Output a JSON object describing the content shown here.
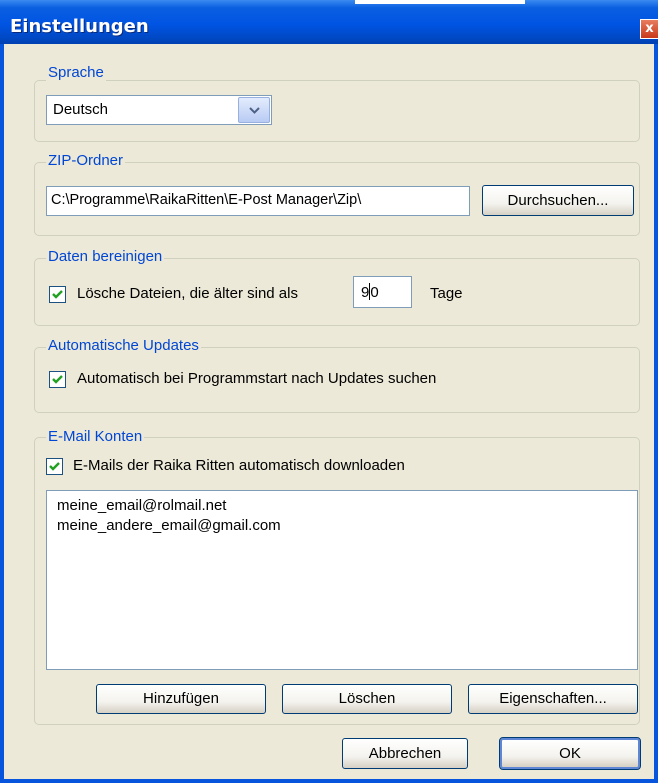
{
  "window": {
    "title": "Einstellungen",
    "close_glyph": "x"
  },
  "language": {
    "legend": "Sprache",
    "selected": "Deutsch"
  },
  "zip": {
    "legend": "ZIP-Ordner",
    "path": "C:\\Programme\\RaikaRitten\\E-Post Manager\\Zip\\",
    "browse_label": "Durchsuchen..."
  },
  "cleanup": {
    "legend": "Daten bereinigen",
    "checkbox_label": "Lösche Dateien, die älter sind als",
    "checked": true,
    "days_part1": "9",
    "days_part2": "0",
    "unit": "Tage"
  },
  "updates": {
    "legend": "Automatische Updates",
    "checkbox_label": "Automatisch bei Programmstart nach Updates suchen",
    "checked": true
  },
  "accounts": {
    "legend": "E-Mail Konten",
    "checkbox_label": "E-Mails der Raika Ritten automatisch downloaden",
    "checked": true,
    "items": [
      "meine_email@rolmail.net",
      "meine_andere_email@gmail.com"
    ],
    "add_label": "Hinzufügen",
    "delete_label": "Löschen",
    "properties_label": "Eigenschaften..."
  },
  "footer": {
    "cancel_label": "Abbrechen",
    "ok_label": "OK"
  },
  "colors": {
    "titlebar": "#0054e3",
    "legend_text": "#0046d5",
    "dialog_bg": "#ece9d8",
    "checkmark": "#21a121"
  }
}
